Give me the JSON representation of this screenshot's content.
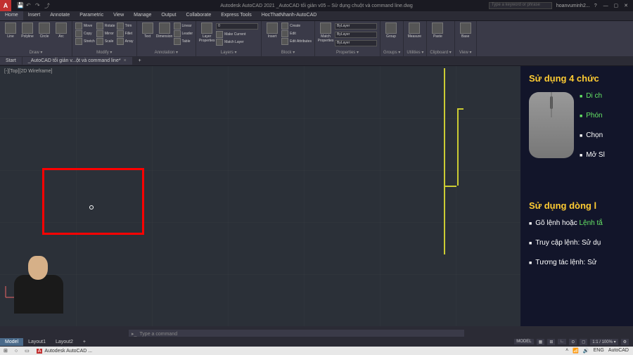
{
  "titlebar": {
    "app_title": "Autodesk AutoCAD 2021   _AutoCAD tối giản v05 – Sử dụng chuột và command line.dwg",
    "search_placeholder": "Type a keyword or phrase",
    "user": "hoanvuminh2...",
    "logo": "A"
  },
  "ribbon_tabs": [
    "Home",
    "Insert",
    "Annotate",
    "Parametric",
    "View",
    "Manage",
    "Output",
    "Collaborate",
    "Express Tools",
    "HocThatNhanh-AutoCAD"
  ],
  "ribbon_panels": {
    "draw": {
      "label": "Draw ▾",
      "items": [
        "Line",
        "Polyline",
        "Circle",
        "Arc"
      ]
    },
    "modify": {
      "label": "Modify ▾",
      "items": [
        "Move",
        "Copy",
        "Stretch",
        "Rotate",
        "Mirror",
        "Scale",
        "Trim",
        "Fillet",
        "Array"
      ]
    },
    "annotation": {
      "label": "Annotation ▾",
      "items": [
        "Text",
        "Dimension",
        "Linear",
        "Leader",
        "Table"
      ]
    },
    "layers": {
      "label": "Layers ▾",
      "items": [
        "Layer Properties"
      ],
      "combo": "0",
      "extra": [
        "Make Current",
        "Match Layer"
      ]
    },
    "block": {
      "label": "Block ▾",
      "items": [
        "Insert",
        "Create",
        "Edit",
        "Edit Attributes"
      ]
    },
    "properties": {
      "label": "Properties ▾",
      "items": [
        "Match Properties"
      ],
      "combos": [
        "ByLayer",
        "ByLayer",
        "ByLayer"
      ]
    },
    "groups": {
      "label": "Groups ▾",
      "items": [
        "Group"
      ]
    },
    "utilities": {
      "label": "Utilities ▾",
      "items": [
        "Measure"
      ]
    },
    "clipboard": {
      "label": "Clipboard ▾",
      "items": [
        "Paste"
      ]
    },
    "view": {
      "label": "View ▾",
      "items": [
        "Base"
      ]
    }
  },
  "doc_tabs": {
    "start": "Start",
    "doc1": "_AutoCAD tối giản v...ột và command line*"
  },
  "canvas": {
    "viewport_label": "[-][Top][2D Wireframe]"
  },
  "slide": {
    "heading1": "Sử dụng 4 chức",
    "bullets1": [
      {
        "text": "Di ch",
        "g": true
      },
      {
        "text": "Phón",
        "g": true
      },
      {
        "text": "Chọn",
        "g": false
      },
      {
        "text": "Mở Sl",
        "g": false
      }
    ],
    "heading2": "Sử dụng dòng l",
    "bullets2": [
      {
        "pre": "Gõ lệnh hoặc ",
        "hl": "Lệnh tắ"
      },
      {
        "pre": "Truy cập lệnh: Sử dụ"
      },
      {
        "pre": "Tương tác lệnh: Sử "
      }
    ]
  },
  "cmdline": {
    "placeholder": "Type a command"
  },
  "layout_tabs": [
    "Model",
    "Layout1",
    "Layout2"
  ],
  "statusbar": {
    "model": "MODEL",
    "scale": "1:1 / 100% ▾"
  },
  "taskbar": {
    "app": "Autodesk AutoCAD ...",
    "lang": "ENG",
    "brand": "AutoCAD"
  }
}
